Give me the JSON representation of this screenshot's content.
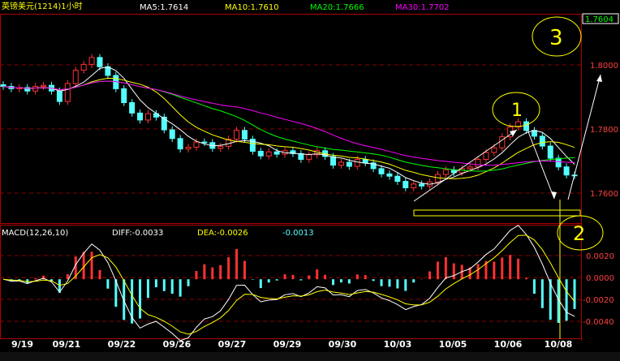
{
  "header": {
    "title": "英镑美元(1214)1小时",
    "ma5": "MA5:1.7614",
    "ma10": "MA10:1.7610",
    "ma20": "MA20:1.7666",
    "ma30": "MA30:1.7702",
    "current_price": "1.7604"
  },
  "macd_header": {
    "label": "MACD(12,26,10)",
    "diff": "DIFF:-0.0033",
    "dea": "DEA:-0.0026",
    "macd": "-0.0013"
  },
  "annotations": {
    "circle_1": "1",
    "circle_2": "2",
    "circle_3": "3"
  },
  "colors": {
    "up": "#ff3232",
    "down": "#54ffff",
    "ma5": "#ffffff",
    "ma10": "#ffff00",
    "ma20": "#00ff00",
    "ma30": "#ff00ff",
    "grid": "#b00000",
    "axis_text": "#ff4040",
    "diff": "#ffffff",
    "dea": "#ffff00"
  },
  "chart_data": [
    {
      "type": "candlestick",
      "title": "英镑美元(1214)1小时",
      "x_tick_labels": [
        "9/19",
        "09/21",
        "09/22",
        "09/26",
        "09/27",
        "09/29",
        "09/30",
        "10/03",
        "10/05",
        "10/06",
        "10/08"
      ],
      "y_tick_labels": [
        "1.8000",
        "1.7800",
        "1.7600"
      ],
      "ylim": [
        1.744,
        1.816
      ],
      "close": [
        1.7912,
        1.7904,
        1.7908,
        1.7896,
        1.7912,
        1.7916,
        1.7896,
        1.786,
        1.7922,
        1.7968,
        1.7988,
        1.8012,
        1.798,
        1.795,
        1.7904,
        1.7856,
        1.782,
        1.7796,
        1.7818,
        1.7806,
        1.7762,
        1.7732,
        1.7696,
        1.7702,
        1.772,
        1.7718,
        1.7698,
        1.7705,
        1.773,
        1.776,
        1.773,
        1.7688,
        1.7672,
        1.7686,
        1.7678,
        1.769,
        1.768,
        1.766,
        1.7676,
        1.769,
        1.767,
        1.764,
        1.765,
        1.7636,
        1.766,
        1.7648,
        1.7628,
        1.761,
        1.7602,
        1.7584,
        1.7562,
        1.7575,
        1.7568,
        1.7582,
        1.7608,
        1.7624,
        1.7614,
        1.7628,
        1.7634,
        1.766,
        1.7684,
        1.77,
        1.7738,
        1.7772,
        1.779,
        1.776,
        1.774,
        1.7706,
        1.7664,
        1.7634,
        1.7606,
        1.7604
      ]
    },
    {
      "type": "macd",
      "title": "MACD(12,26,10)",
      "y_tick_labels": [
        "0.0020",
        "0.0000",
        "-0.0020",
        "-0.0040"
      ],
      "ylim": [
        -0.0046,
        0.003
      ],
      "diff": -0.0033,
      "dea": -0.0026,
      "macd": -0.0013
    }
  ]
}
